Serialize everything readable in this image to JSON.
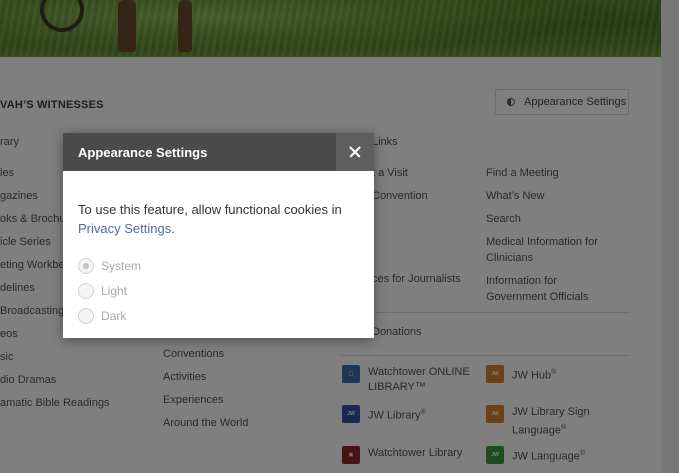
{
  "header": {
    "site_title": "VAH’S WITNESSES",
    "appearance_button": "Appearance Settings"
  },
  "columns": {
    "library_head": "rary",
    "library_items": [
      "les",
      "gazines",
      "oks & Brochu",
      "icle Series",
      "eting Workbe",
      "delines",
      "Broadcasting",
      "eos",
      "sic",
      "dio Dramas",
      "amatic Bible Readings"
    ],
    "middle_items": [
      "Conventions",
      "Activities",
      "Experiences",
      "Around the World"
    ],
    "links_head": "Links",
    "links_left": [
      "t a Visit",
      "Convention",
      "",
      "",
      "ces for Journalists"
    ],
    "links_right": [
      "Find a Meeting",
      "What’s New",
      "Search",
      "Medical Information for Clinicians",
      "Information for Government Officials"
    ],
    "donations": "Donations"
  },
  "apps": [
    {
      "label": "Watchtower ONLINE LIBRARY™",
      "sup": "",
      "icon": "wol-icon",
      "color": "#3b6ea8"
    },
    {
      "label": "JW Hub",
      "sup": "®",
      "icon": "jw-hub-icon",
      "color": "#d9822b"
    },
    {
      "label": "JW Library",
      "sup": "®",
      "icon": "jw-library-icon",
      "color": "#3b4fa8"
    },
    {
      "label": "JW Library Sign Language",
      "sup": "®",
      "icon": "jw-library-sign-icon",
      "color": "#d9822b"
    },
    {
      "label": "Watchtower Library",
      "sup": "",
      "icon": "watchtower-library-icon",
      "color": "#8a2a2a"
    },
    {
      "label": "JW Language",
      "sup": "®",
      "icon": "jw-language-icon",
      "color": "#3a9a3a"
    }
  ],
  "modal": {
    "title": "Appearance Settings",
    "message": "To use this feature, allow functional cookies in ",
    "link": "Privacy Settings",
    "period": ".",
    "options": [
      "System",
      "Light",
      "Dark"
    ],
    "selected": "System"
  }
}
